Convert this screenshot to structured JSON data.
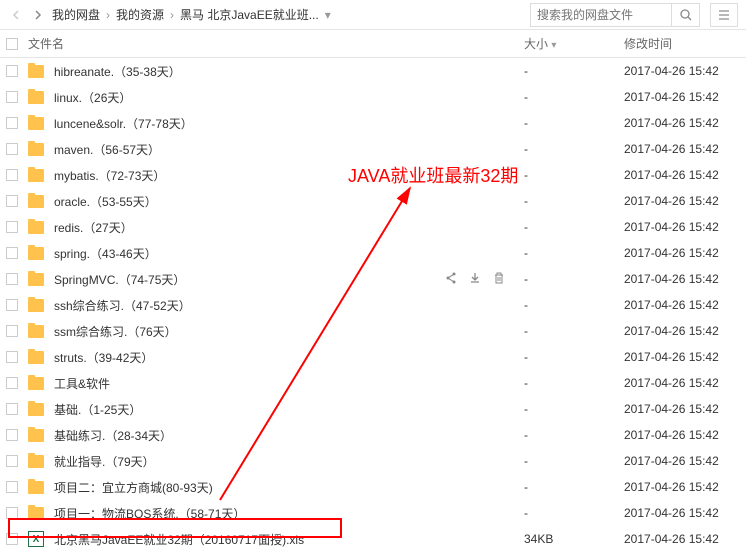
{
  "breadcrumb": {
    "items": [
      "我的网盘",
      "我的资源",
      "黑马 北京JavaEE就业班..."
    ]
  },
  "search": {
    "placeholder": "搜索我的网盘文件"
  },
  "columns": {
    "name": "文件名",
    "size": "大小",
    "date": "修改时间"
  },
  "annotation": {
    "text": "JAVA就业班最新32期"
  },
  "files": [
    {
      "name": "hibreanate.（35-38天）",
      "type": "folder",
      "size": "-",
      "date": "2017-04-26 15:42"
    },
    {
      "name": "linux.（26天）",
      "type": "folder",
      "size": "-",
      "date": "2017-04-26 15:42"
    },
    {
      "name": "luncene&solr.（77-78天）",
      "type": "folder",
      "size": "-",
      "date": "2017-04-26 15:42"
    },
    {
      "name": "maven.（56-57天）",
      "type": "folder",
      "size": "-",
      "date": "2017-04-26 15:42"
    },
    {
      "name": "mybatis.（72-73天）",
      "type": "folder",
      "size": "-",
      "date": "2017-04-26 15:42"
    },
    {
      "name": "oracle.（53-55天）",
      "type": "folder",
      "size": "-",
      "date": "2017-04-26 15:42"
    },
    {
      "name": "redis.（27天）",
      "type": "folder",
      "size": "-",
      "date": "2017-04-26 15:42"
    },
    {
      "name": "spring.（43-46天）",
      "type": "folder",
      "size": "-",
      "date": "2017-04-26 15:42"
    },
    {
      "name": "SpringMVC.（74-75天）",
      "type": "folder",
      "size": "-",
      "date": "2017-04-26 15:42",
      "active": true
    },
    {
      "name": "ssh综合练习.（47-52天）",
      "type": "folder",
      "size": "-",
      "date": "2017-04-26 15:42"
    },
    {
      "name": "ssm综合练习.（76天）",
      "type": "folder",
      "size": "-",
      "date": "2017-04-26 15:42"
    },
    {
      "name": "struts.（39-42天）",
      "type": "folder",
      "size": "-",
      "date": "2017-04-26 15:42"
    },
    {
      "name": "工具&软件",
      "type": "folder",
      "size": "-",
      "date": "2017-04-26 15:42"
    },
    {
      "name": "基础.（1-25天）",
      "type": "folder",
      "size": "-",
      "date": "2017-04-26 15:42"
    },
    {
      "name": "基础练习.（28-34天）",
      "type": "folder",
      "size": "-",
      "date": "2017-04-26 15:42"
    },
    {
      "name": "就业指导.（79天）",
      "type": "folder",
      "size": "-",
      "date": "2017-04-26 15:42"
    },
    {
      "name": "项目二：宜立方商城(80-93天)",
      "type": "folder",
      "size": "-",
      "date": "2017-04-26 15:42"
    },
    {
      "name": "项目一：物流BOS系统.（58-71天）",
      "type": "folder",
      "size": "-",
      "date": "2017-04-26 15:42"
    },
    {
      "name": "北京黑马JavaEE就业32期（20160717面授).xls",
      "type": "excel",
      "size": "34KB",
      "date": "2017-04-26 15:42"
    }
  ]
}
